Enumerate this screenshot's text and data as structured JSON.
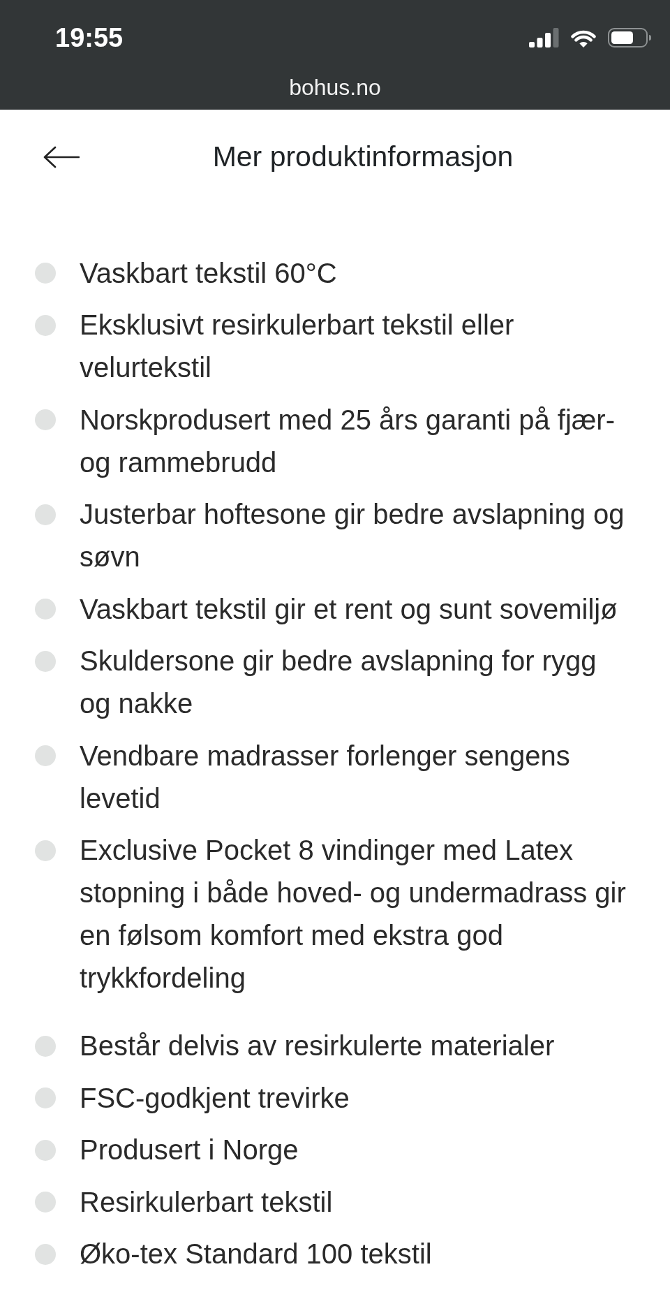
{
  "status_bar": {
    "time": "19:55",
    "url": "bohus.no"
  },
  "header": {
    "title": "Mer produktinformasjon"
  },
  "feature_lists": [
    {
      "items": [
        "Vaskbart tekstil 60°C",
        "Eksklusivt resirkulerbart tekstil eller velurtekstil",
        "Norskprodusert med 25 års garanti på fjær- og rammebrudd",
        "Justerbar hoftesone gir bedre avslapning og søvn",
        "Vaskbart tekstil gir et rent og sunt sovemiljø",
        "Skuldersone gir bedre avslapning for rygg og nakke",
        "Vendbare madrasser forlenger sengens levetid",
        "Exclusive Pocket 8 vindinger med Latex stopning i både hoved- og undermadrass gir en følsom komfort med ekstra god trykkfordeling"
      ]
    },
    {
      "items": [
        "Består delvis av resirkulerte materialer",
        "FSC-godkjent trevirke",
        "Produsert i Norge",
        "Resirkulerbart tekstil",
        "Øko-tex Standard 100 tekstil"
      ]
    }
  ]
}
